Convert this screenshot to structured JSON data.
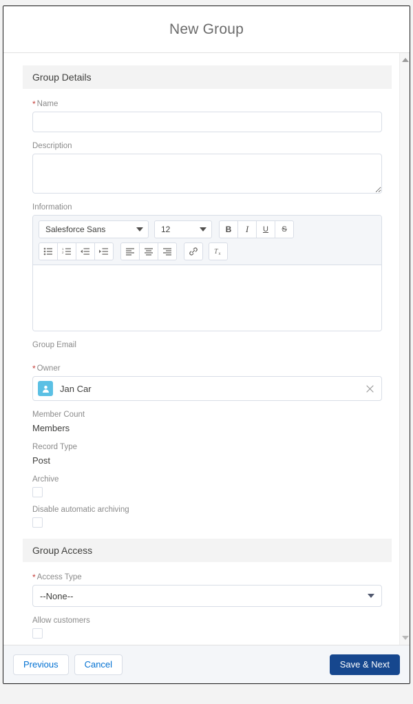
{
  "modal": {
    "title": "New Group"
  },
  "sections": {
    "group_details": "Group Details",
    "group_access": "Group Access"
  },
  "fields": {
    "name": {
      "label": "Name",
      "required": true,
      "value": "",
      "placeholder": ""
    },
    "description": {
      "label": "Description",
      "required": false,
      "value": "",
      "placeholder": ""
    },
    "information": {
      "label": "Information",
      "required": false,
      "value": ""
    },
    "group_email": {
      "label": "Group Email",
      "required": false,
      "value": ""
    },
    "owner": {
      "label": "Owner",
      "required": true,
      "value": "Jan Car",
      "clear_label": "×"
    },
    "member_count": {
      "label": "Member Count",
      "value": "Members"
    },
    "record_type": {
      "label": "Record Type",
      "value": "Post"
    },
    "archive": {
      "label": "Archive",
      "checked": false
    },
    "disable_auto_archiving": {
      "label": "Disable automatic archiving",
      "checked": false
    },
    "access_type": {
      "label": "Access Type",
      "required": true,
      "value": "--None--"
    },
    "allow_customers": {
      "label": "Allow customers",
      "checked": false
    }
  },
  "rich_text": {
    "font_family": "Salesforce Sans",
    "font_size": "12",
    "buttons": {
      "bold": "B",
      "italic": "I",
      "underline": "U",
      "strikethrough": "S",
      "bulleted_list": "bulleted-list-icon",
      "numbered_list": "numbered-list-icon",
      "outdent": "outdent-icon",
      "indent": "indent-icon",
      "align_left": "align-left-icon",
      "align_center": "align-center-icon",
      "align_right": "align-right-icon",
      "link": "link-icon",
      "remove_formatting": "remove-formatting-icon"
    }
  },
  "footer": {
    "previous": "Previous",
    "cancel": "Cancel",
    "save_next": "Save & Next"
  },
  "scrollbar": {
    "up": "scroll-up-icon",
    "down": "scroll-down-icon"
  },
  "colors": {
    "brand_blue": "#16478e",
    "link_blue": "#0070d2",
    "required_red": "#c23934",
    "avatar_blue": "#5bc0e4",
    "section_bg": "#f3f3f3"
  }
}
